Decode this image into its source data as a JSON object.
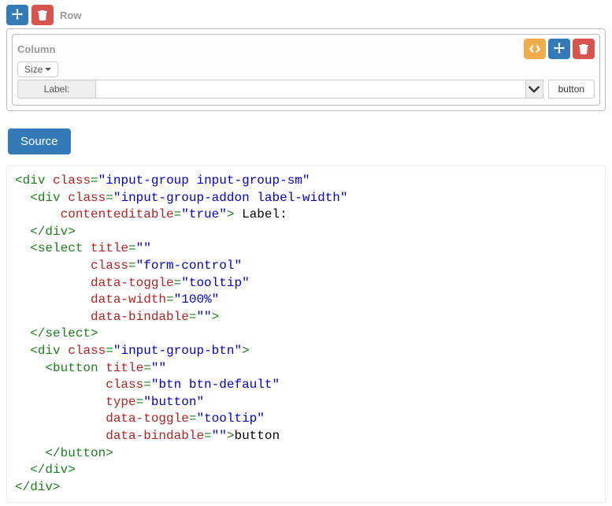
{
  "row": {
    "label": "Row"
  },
  "column": {
    "label": "Column",
    "size_label": "Size",
    "field_label": "Label:",
    "button_label": "button"
  },
  "source_btn": "Source",
  "code": [
    {
      "indent": 0,
      "type": "open",
      "tag": "div",
      "attrs": [
        [
          "class",
          "input-group input-group-sm"
        ]
      ]
    },
    {
      "indent": 1,
      "type": "open",
      "tag": "div",
      "attrs": [
        [
          "class",
          "input-group-addon label-width"
        ]
      ]
    },
    {
      "indent": 3,
      "type": "attrline",
      "attrs": [
        [
          "contenteditable",
          "true"
        ]
      ],
      "close": true,
      "trailing": " Label:"
    },
    {
      "indent": 1,
      "type": "close",
      "tag": "div"
    },
    {
      "indent": 1,
      "type": "open",
      "tag": "select",
      "attrs": [
        [
          "title",
          ""
        ]
      ]
    },
    {
      "indent": 5,
      "type": "attrline",
      "attrs": [
        [
          "class",
          "form-control"
        ]
      ]
    },
    {
      "indent": 5,
      "type": "attrline",
      "attrs": [
        [
          "data-toggle",
          "tooltip"
        ]
      ]
    },
    {
      "indent": 5,
      "type": "attrline",
      "attrs": [
        [
          "data-width",
          "100%"
        ]
      ]
    },
    {
      "indent": 5,
      "type": "attrline",
      "attrs": [
        [
          "data-bindable",
          ""
        ]
      ],
      "close": true
    },
    {
      "indent": 1,
      "type": "close",
      "tag": "select"
    },
    {
      "indent": 1,
      "type": "open",
      "tag": "div",
      "attrs": [
        [
          "class",
          "input-group-btn"
        ]
      ],
      "close_inline": true
    },
    {
      "indent": 2,
      "type": "open",
      "tag": "button",
      "attrs": [
        [
          "title",
          ""
        ]
      ]
    },
    {
      "indent": 6,
      "type": "attrline",
      "attrs": [
        [
          "class",
          "btn btn-default"
        ]
      ]
    },
    {
      "indent": 6,
      "type": "attrline",
      "attrs": [
        [
          "type",
          "button"
        ]
      ]
    },
    {
      "indent": 6,
      "type": "attrline",
      "attrs": [
        [
          "data-toggle",
          "tooltip"
        ]
      ]
    },
    {
      "indent": 6,
      "type": "attrline",
      "attrs": [
        [
          "data-bindable",
          ""
        ]
      ],
      "close": true,
      "trailing": "button"
    },
    {
      "indent": 2,
      "type": "close",
      "tag": "button"
    },
    {
      "indent": 1,
      "type": "close",
      "tag": "div"
    },
    {
      "indent": 0,
      "type": "close",
      "tag": "div"
    }
  ]
}
